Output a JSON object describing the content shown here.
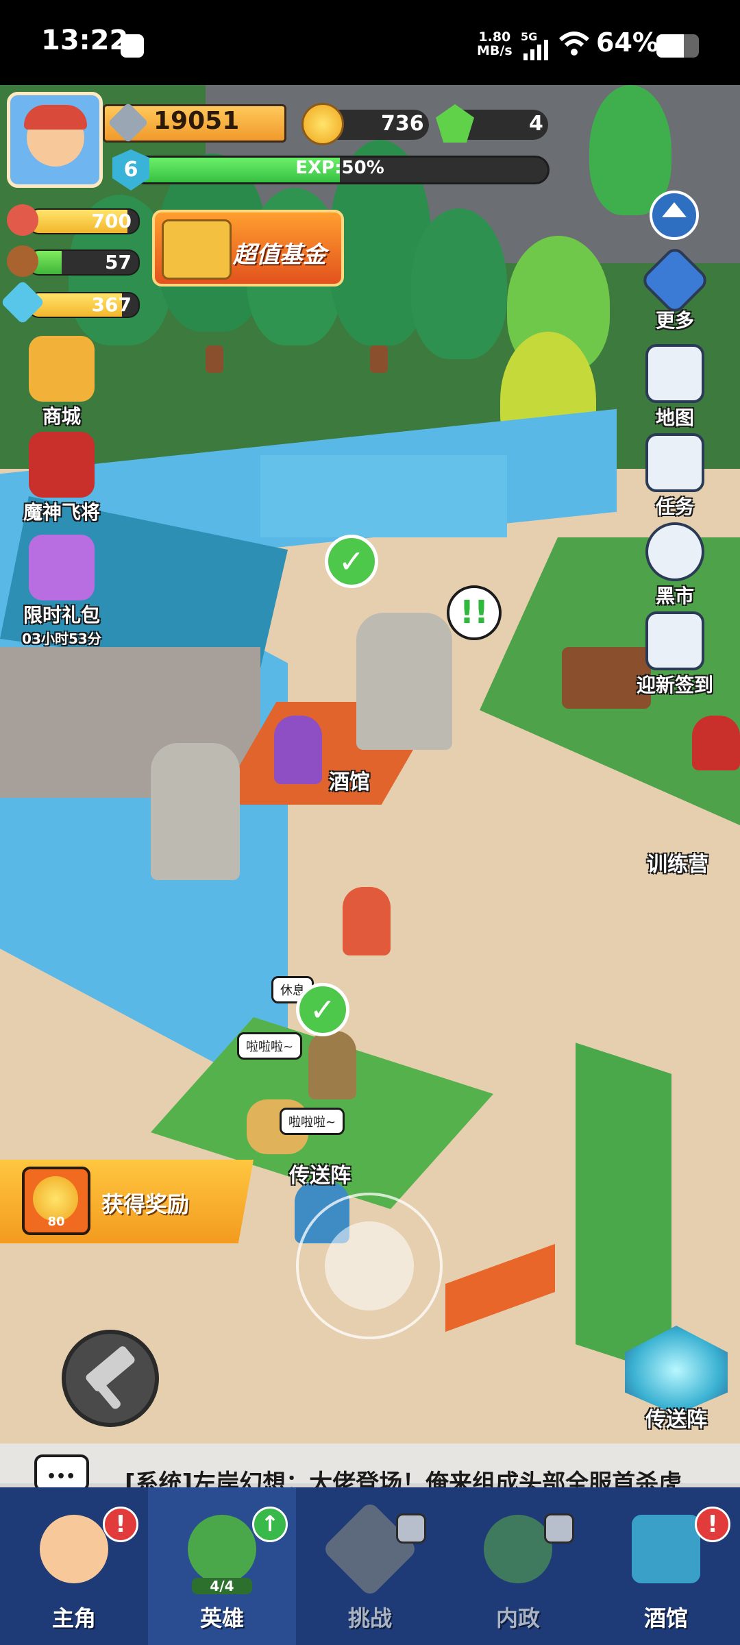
{
  "status_bar": {
    "time": "13:22",
    "speed_value": "1.80",
    "speed_unit": "MB/s",
    "network": "5G",
    "battery": "64%",
    "battery_level": 0.64
  },
  "hud": {
    "power": "19051",
    "gold": "736",
    "gems": "4",
    "level": "6",
    "exp_text": "EXP:50%",
    "exp_fraction": 0.5,
    "stocks": [
      {
        "value": "700",
        "fill": 0.9
      },
      {
        "value": "57",
        "fill": 0.3
      },
      {
        "value": "367",
        "fill": 0.85
      }
    ],
    "fund_label": "超值基金"
  },
  "left_menu": {
    "shop": "商城",
    "general": "魔神飞将",
    "gift": "限时礼包",
    "gift_timer": "03小时53分"
  },
  "right_menu": {
    "more": "更多",
    "map": "地图",
    "tasks": "任务",
    "black_market": "黑市",
    "checkin": "迎新签到"
  },
  "scene": {
    "tavern": "酒馆",
    "training": "训练营",
    "portal": "传送阵",
    "bubble_rest": "休息",
    "bubble_1": "啦啦啦~",
    "bubble_2": "啦啦啦~"
  },
  "reward": {
    "label": "获得奖励",
    "count": "80"
  },
  "portal_button": "传送阵",
  "chat": {
    "message": "[系统]左岸幻想：大佬登场！俺来组成头部全服首杀虎"
  },
  "nav": [
    {
      "label": "主角",
      "badge": "!"
    },
    {
      "label": "英雄",
      "count": "4/4",
      "badge": "↑"
    },
    {
      "label": "挑战",
      "locked": true
    },
    {
      "label": "内政",
      "locked": true
    },
    {
      "label": "酒馆",
      "badge": "!"
    }
  ],
  "colors": {
    "nav_bg": "#1f3b77",
    "exp_green": "#2fb83c",
    "badge_red": "#e23b3b",
    "reward_orange": "#f39b1e"
  }
}
